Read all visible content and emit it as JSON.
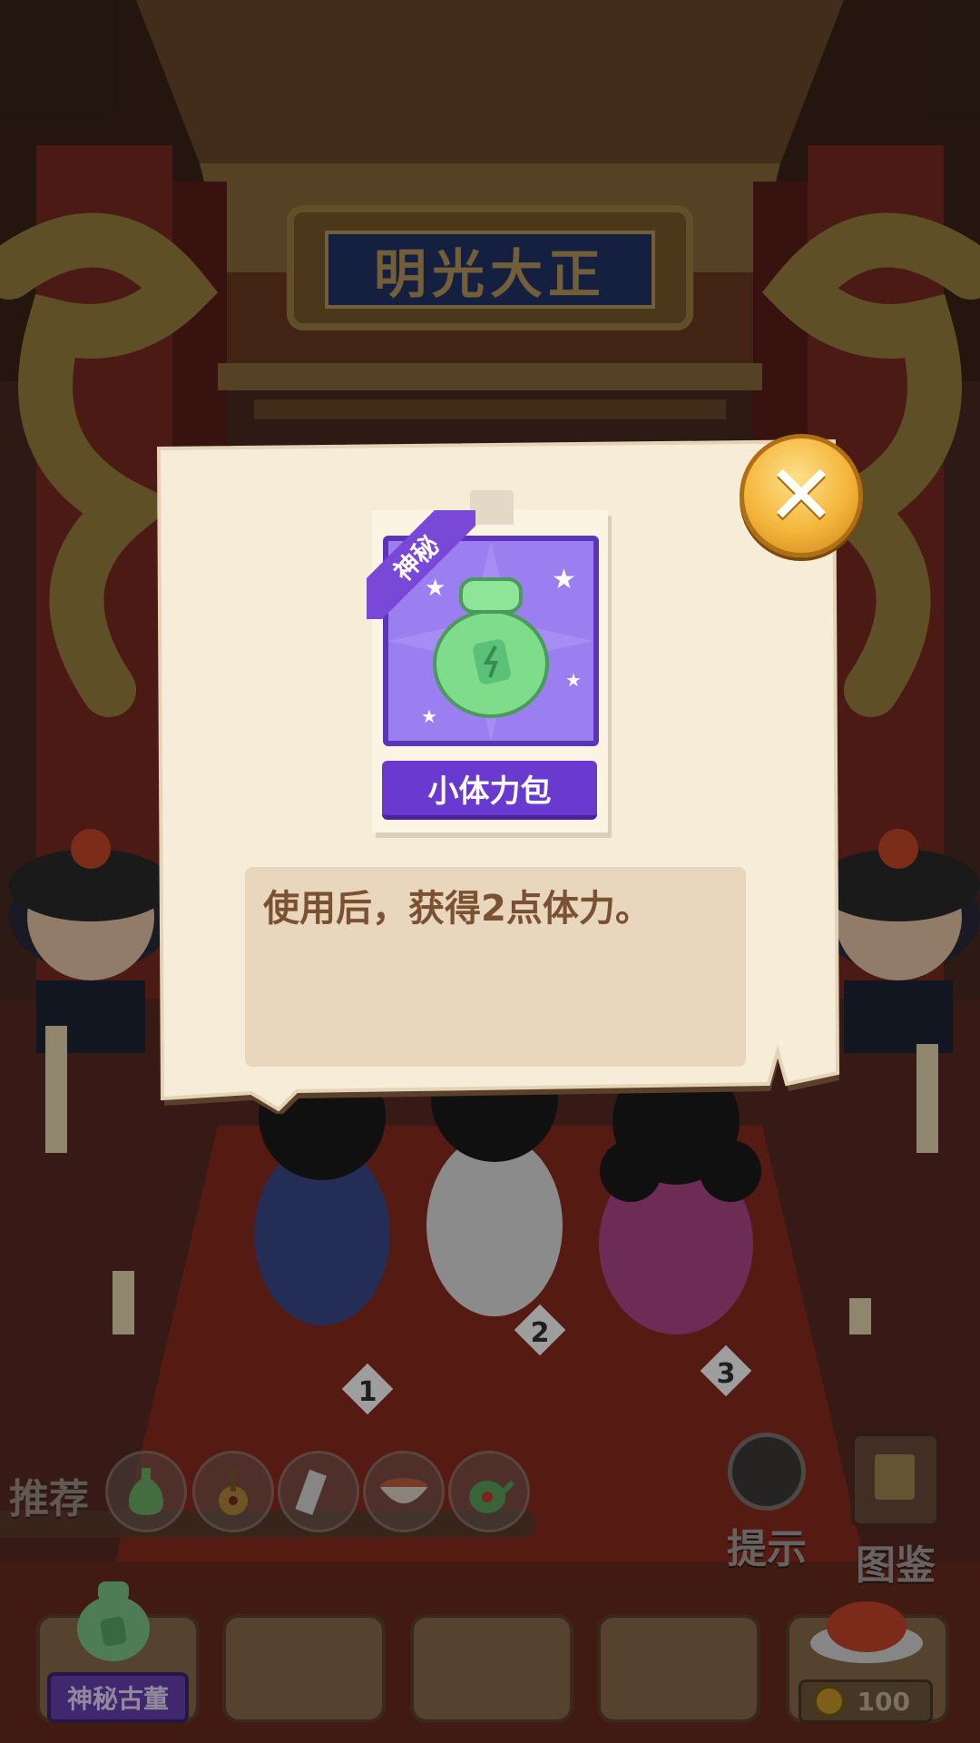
{
  "scene": {
    "plaque_text": "明光大正"
  },
  "dialog": {
    "card_tag": "神秘",
    "item_name": "小体力包",
    "description": "使用后，获得2点体力。",
    "close_icon": "close-icon"
  },
  "bottom_bar": {
    "recommend_label": "推荐",
    "recommend_items": [
      "vase-icon",
      "lute-icon",
      "scroll-icon",
      "bowl-icon",
      "teapot-icon"
    ],
    "hint_label": "提示",
    "catalog_label": "图鉴",
    "slot_label": "神秘古董",
    "coins": "100"
  },
  "colors": {
    "accent_purple": "#6a3ad0",
    "dialog_paper": "#f6ecd8",
    "close_gold": "#f3b53a"
  }
}
